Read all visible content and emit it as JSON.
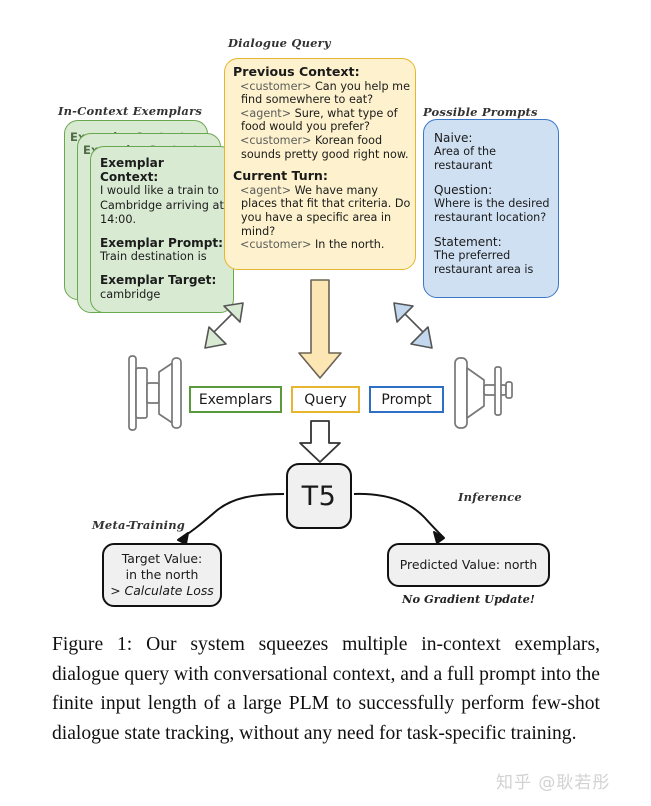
{
  "figure": {
    "sections": {
      "exemplars_label": "In-Context Exemplars",
      "query_label": "Dialogue Query",
      "prompts_label": "Possible Prompts",
      "meta_training_label": "Meta-Training",
      "inference_label": "Inference"
    },
    "exemplar_card": {
      "ghost_heading_1": "Exemplar Context:",
      "ghost_heading_2": "Exemplar Context:",
      "context_heading": "Exemplar Context:",
      "context_text": "I would like a train to Cambridge arriving at 14:00.",
      "prompt_heading": "Exemplar Prompt:",
      "prompt_text": "Train destination is",
      "target_heading": "Exemplar Target:",
      "target_text": "cambridge"
    },
    "query": {
      "previous_heading": "Previous Context:",
      "turns": [
        {
          "speaker": "<customer>",
          "text": "Can you help me find somewhere to eat?"
        },
        {
          "speaker": "<agent>",
          "text": "Sure, what type of food would you prefer?"
        },
        {
          "speaker": "<customer>",
          "text": "Korean food sounds pretty good right now."
        }
      ],
      "current_heading": "Current Turn:",
      "current_turns": [
        {
          "speaker": "<agent>",
          "text": "We have many places that fit that criteria.  Do you have a specific area in mind?"
        },
        {
          "speaker": "<customer>",
          "text": "In the north."
        }
      ]
    },
    "prompts": [
      {
        "heading": "Naive:",
        "text": "Area of the restaurant"
      },
      {
        "heading": "Question:",
        "text": "Where is the desired restaurant location?"
      },
      {
        "heading": "Statement:",
        "text": "The preferred restaurant area is"
      }
    ],
    "tags": {
      "exemplars": "Exemplars",
      "query": "Query",
      "prompt": "Prompt"
    },
    "model": {
      "name": "T5"
    },
    "outputs": {
      "target_heading": "Target Value:",
      "target_value": "in the north",
      "target_note": "> Calculate Loss",
      "predicted": "Predicted Value: north",
      "no_gradient": "No Gradient Update!"
    },
    "colors": {
      "green_fill": "#d9ead3",
      "green_stroke": "#6aa84f",
      "amber_fill": "#fdf2cd",
      "amber_stroke": "#e8b52e",
      "blue_fill": "#cfe0f3",
      "blue_stroke": "#3c78c8",
      "box_fill": "#f0f0f0",
      "box_stroke": "#111111"
    }
  },
  "caption": {
    "text": "Figure 1: Our system squeezes multiple in-context exemplars, dialogue query with conversational context, and a full prompt into the finite input length of a large PLM to successfully perform few-shot dialogue state tracking, without any need for task-specific training."
  },
  "watermark": {
    "text": "知乎 @耿若彤"
  }
}
